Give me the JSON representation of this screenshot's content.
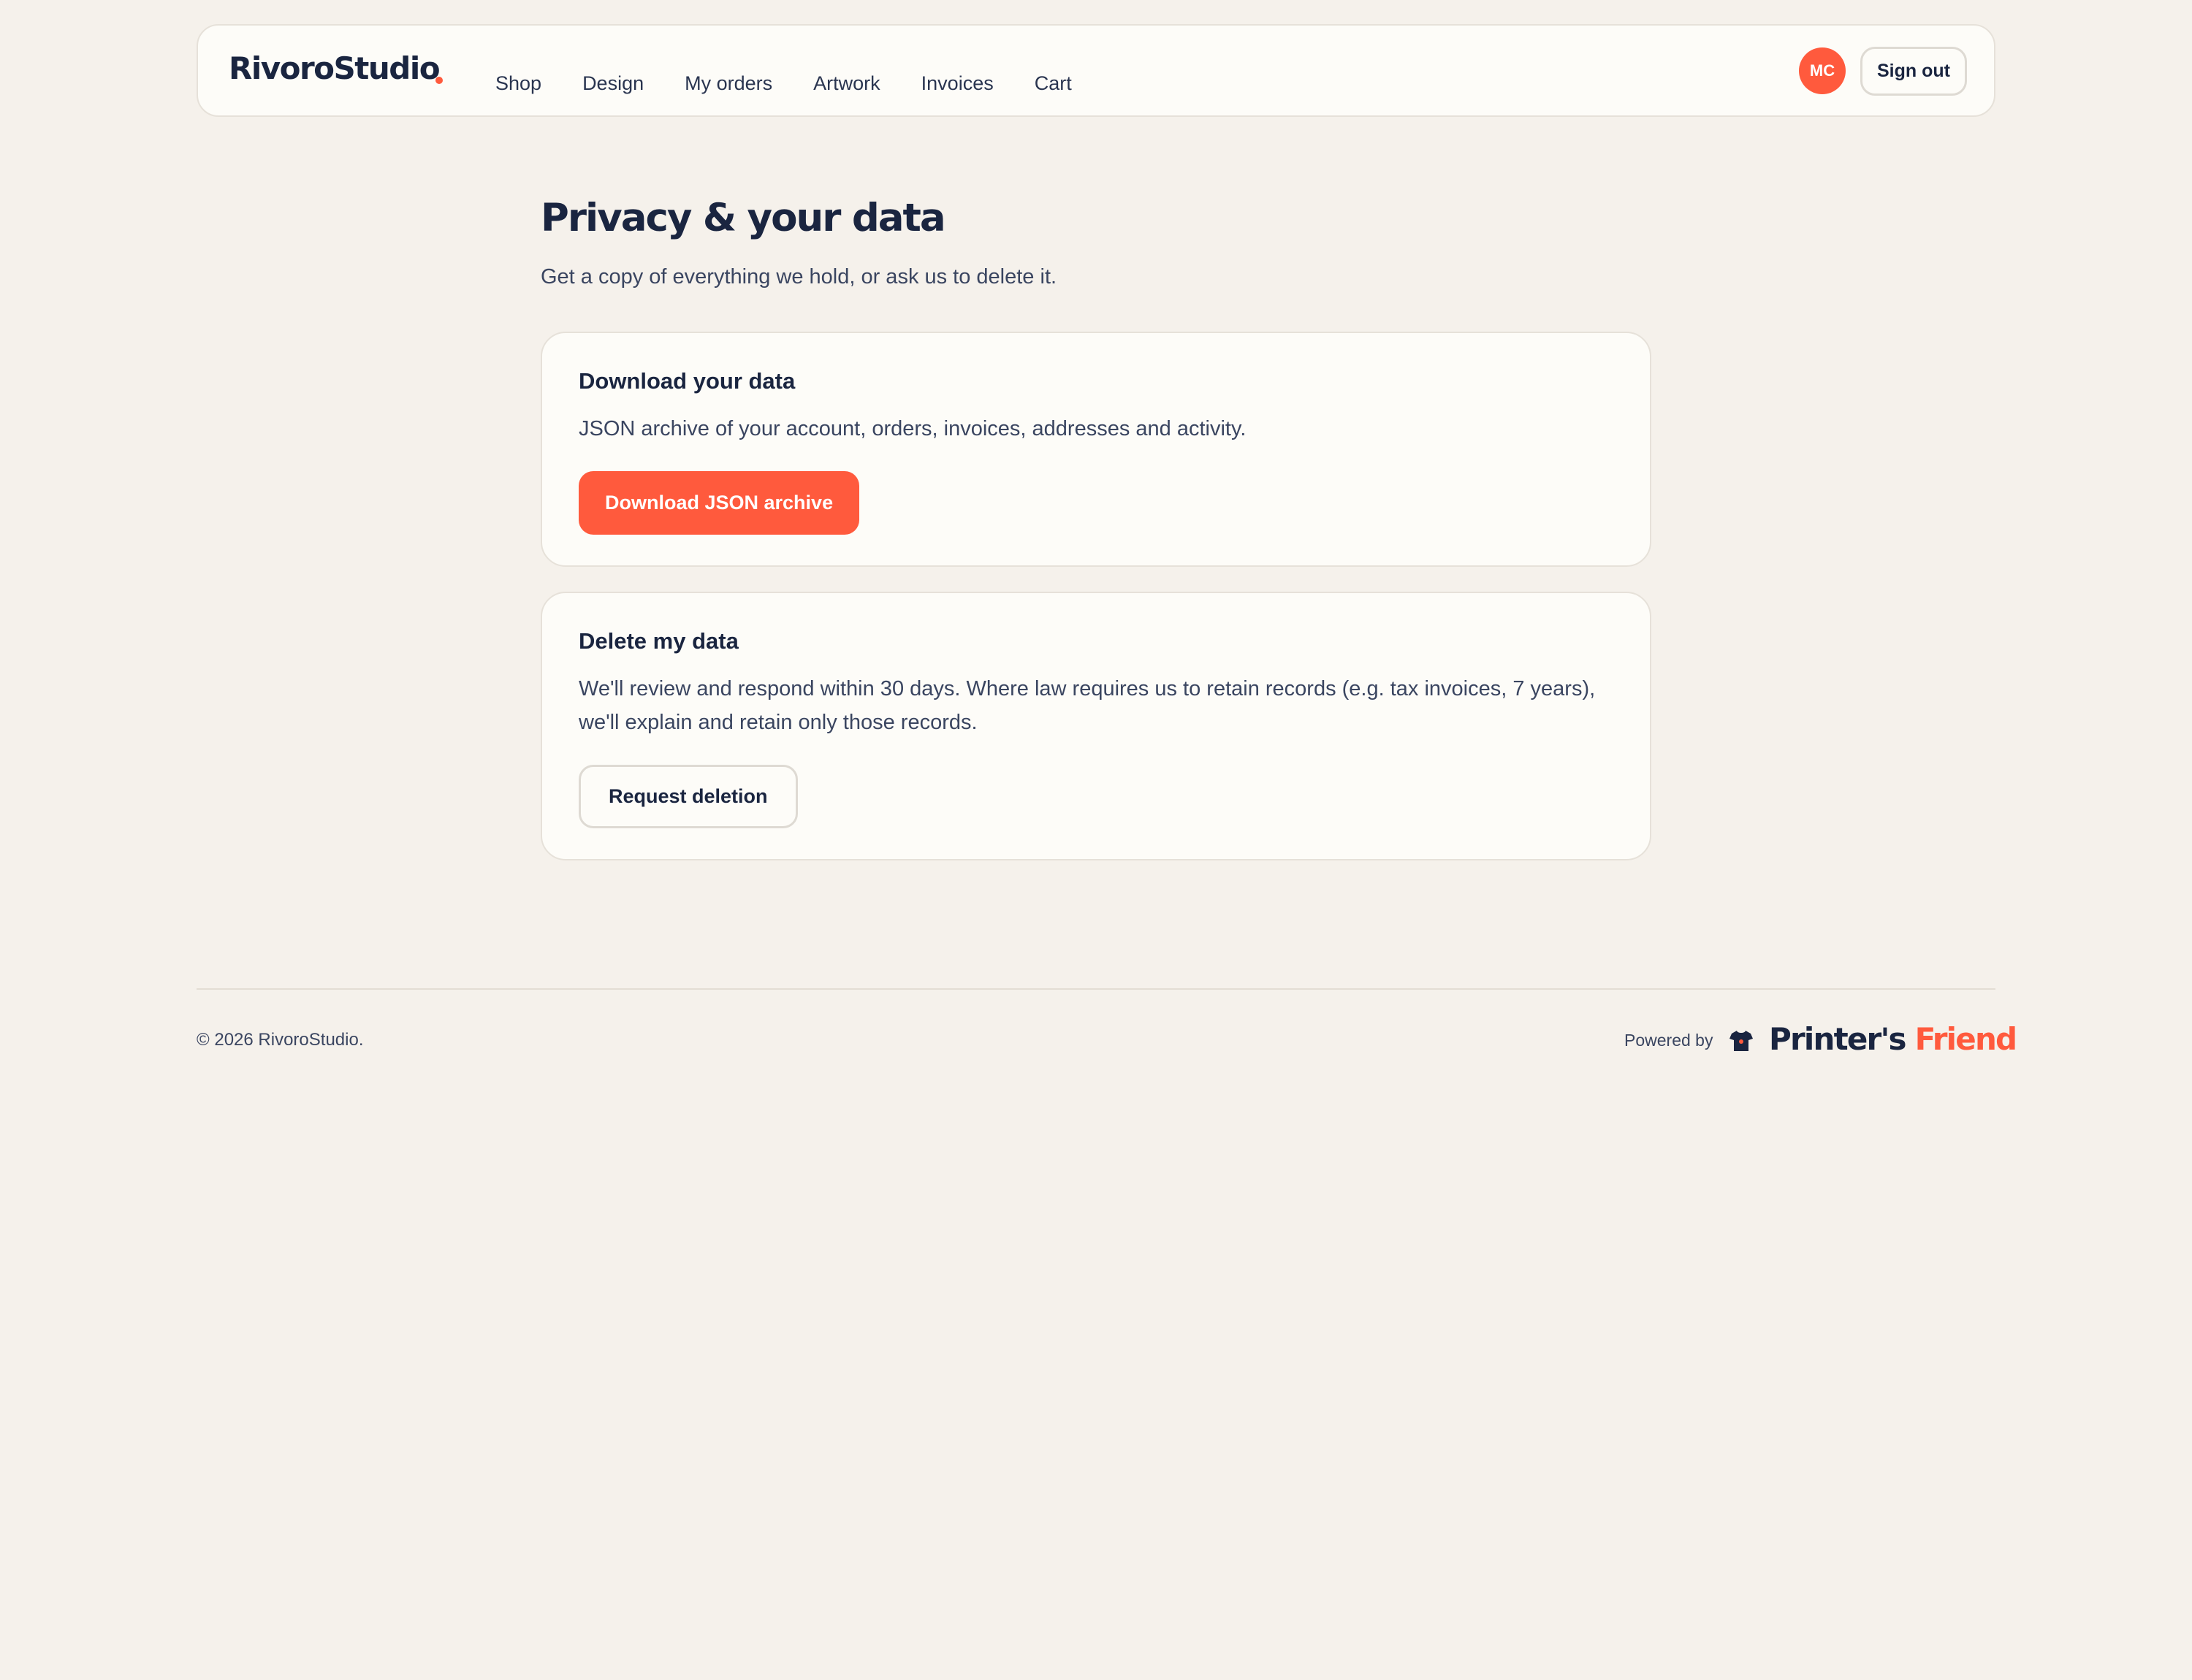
{
  "brand": {
    "name": "RivoroStudio"
  },
  "nav": {
    "items": [
      {
        "label": "Shop"
      },
      {
        "label": "Design"
      },
      {
        "label": "My orders"
      },
      {
        "label": "Artwork"
      },
      {
        "label": "Invoices"
      },
      {
        "label": "Cart"
      }
    ]
  },
  "user": {
    "initials": "MC",
    "sign_out_label": "Sign out"
  },
  "page": {
    "title": "Privacy & your data",
    "subtitle": "Get a copy of everything we hold, or ask us to delete it."
  },
  "download_card": {
    "title": "Download your data",
    "body": "JSON archive of your account, orders, invoices, addresses and activity.",
    "button_label": "Download JSON archive"
  },
  "delete_card": {
    "title": "Delete my data",
    "body": "We'll review and respond within 30 days. Where law requires us to retain records (e.g. tax invoices, 7 years), we'll explain and retain only those records.",
    "button_label": "Request deletion"
  },
  "footer": {
    "copyright": "© 2026 RivoroStudio.",
    "powered_by": "Powered by",
    "partner_name_part1": "Printer's",
    "partner_name_part2": "Friend",
    "partner_icon": "tshirt-icon"
  },
  "colors": {
    "accent": "#ff5a3d",
    "ink": "#1a2540",
    "background": "#f5f1eb",
    "card": "#fdfcf8"
  }
}
